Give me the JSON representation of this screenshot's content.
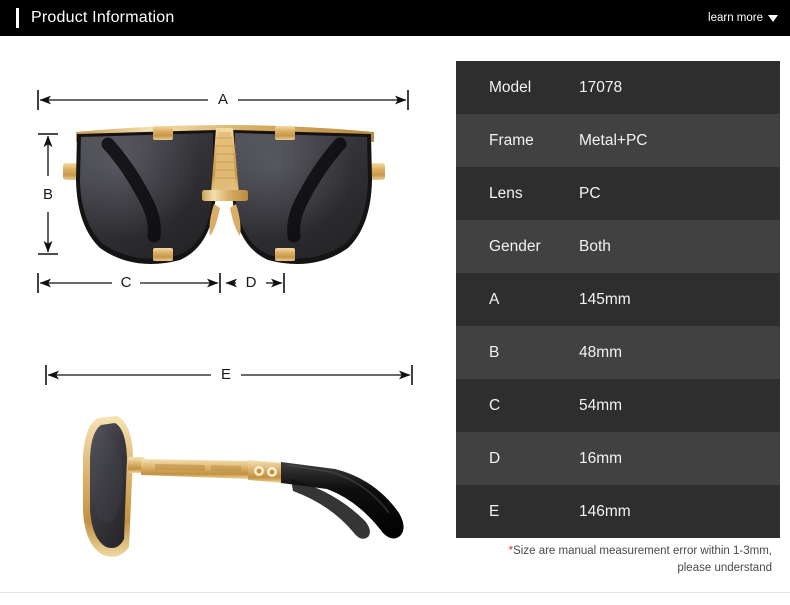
{
  "header": {
    "title": "Product Information",
    "learn_more_label": "learn more",
    "caret_icon": "chevron-down-icon"
  },
  "diagram": {
    "front_view_alt": "sunglasses-front-view",
    "side_view_alt": "sunglasses-side-view",
    "dimension_labels": {
      "a": "A",
      "b": "B",
      "c": "C",
      "d": "D",
      "e": "E"
    }
  },
  "spec_table": {
    "rows": [
      {
        "key": "Model",
        "value": "17078"
      },
      {
        "key": "Frame",
        "value": "Metal+PC"
      },
      {
        "key": "Lens",
        "value": "PC"
      },
      {
        "key": "Gender",
        "value": "Both"
      },
      {
        "key": "A",
        "value": "145mm"
      },
      {
        "key": "B",
        "value": "48mm"
      },
      {
        "key": "C",
        "value": "54mm"
      },
      {
        "key": "D",
        "value": "16mm"
      },
      {
        "key": "E",
        "value": "146mm"
      }
    ]
  },
  "note": {
    "star": "*",
    "line1": "Size are manual measurement error within 1-3mm,",
    "line2": "please understand"
  },
  "colors": {
    "header_bg": "#000000",
    "row_dark": "#2e2e2e",
    "row_light": "#414141",
    "note_star": "#e8282b",
    "gold": "#d9ab5e",
    "lens": "#2f2f33"
  }
}
